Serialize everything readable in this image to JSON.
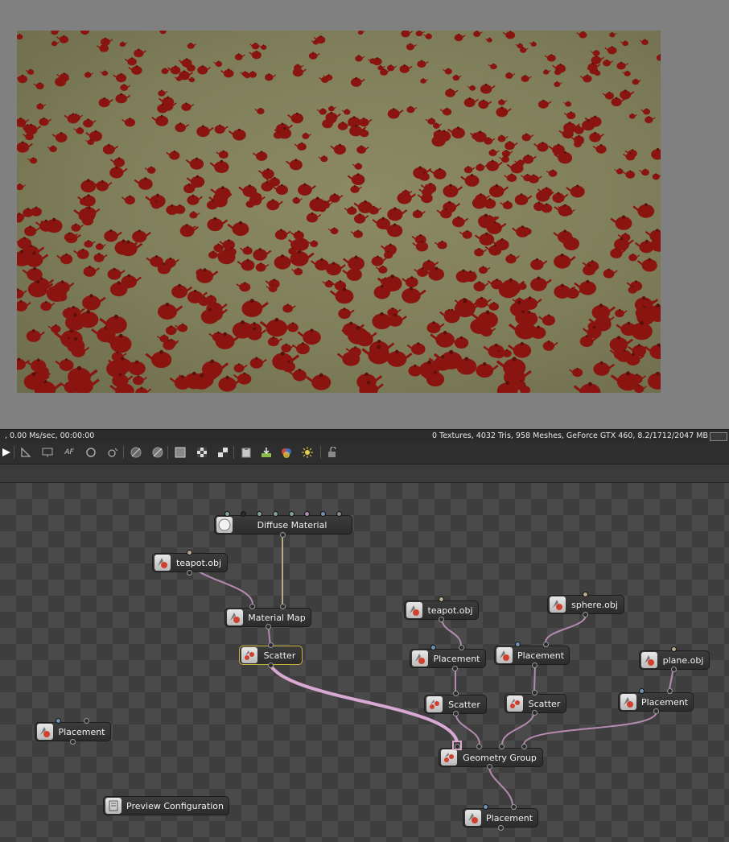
{
  "status": {
    "left": ", 0.00 Ms/sec, 00:00:00",
    "right": "0 Textures, 4032 Tris, 958 Meshes, GeForce GTX 460, 8.2/1712/2047 MB"
  },
  "toolbar": {
    "icons": [
      "play-icon",
      "ruler-icon",
      "monitor-icon",
      "af-icon",
      "rotate-icon",
      "camera-target-icon",
      "sphere-dark-icon",
      "sphere-alt-icon",
      "checker-fine-icon",
      "checker-icon",
      "checker-large-icon",
      "clipboard-icon",
      "import-icon",
      "render-color-icon",
      "light-icon",
      "lock-icon"
    ]
  },
  "nodes": {
    "diffuse_material": "Diffuse Material",
    "teapot_obj_1": "teapot.obj",
    "material_map": "Material Map",
    "scatter_1": "Scatter",
    "placement_left": "Placement",
    "preview_configuration": "Preview Configuration",
    "teapot_obj_2": "teapot.obj",
    "sphere_obj": "sphere.obj",
    "placement_2": "Placement",
    "placement_3": "Placement",
    "plane_obj": "plane.obj",
    "scatter_2": "Scatter",
    "scatter_3": "Scatter",
    "placement_4": "Placement",
    "geometry_group": "Geometry Group",
    "placement_out": "Placement"
  },
  "colors": {
    "teapot": "#8a1510",
    "ground": "#85845f",
    "wire_geometry": "#b58ab0",
    "wire_material": "#b7ab8a"
  }
}
